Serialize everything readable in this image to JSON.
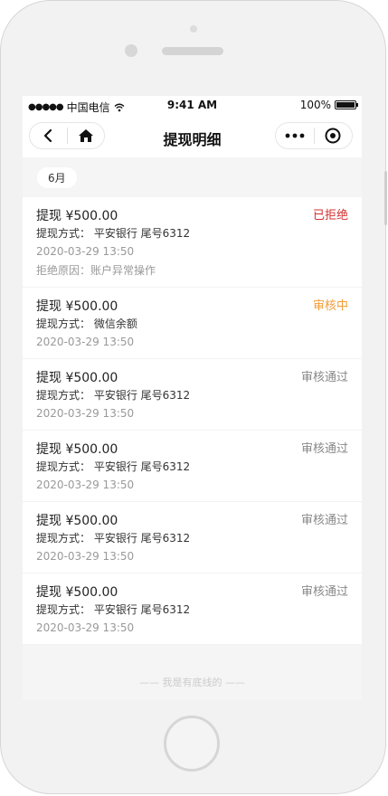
{
  "status_bar": {
    "signal": "●●●●●",
    "carrier": "中国电信",
    "time": "9:41 AM",
    "battery": "100%"
  },
  "nav": {
    "title": "提现明细",
    "icons": {
      "back": "chevron-left-icon",
      "home": "home-icon",
      "more": "more-dots-icon",
      "close": "target-circle-icon"
    }
  },
  "month_label": "6月",
  "colors": {
    "rejected": "#d43030",
    "pending": "#f29d38",
    "approved": "#888888"
  },
  "records": [
    {
      "amount": "提现 ¥500.00",
      "method": "提现方式： 平安银行 尾号6312",
      "time": "2020-03-29 13:50",
      "status": "已拒绝",
      "status_type": "rejected",
      "reason": "拒绝原因：账户异常操作"
    },
    {
      "amount": "提现 ¥500.00",
      "method": "提现方式： 微信余额",
      "time": "2020-03-29 13:50",
      "status": "审核中",
      "status_type": "pending"
    },
    {
      "amount": "提现 ¥500.00",
      "method": "提现方式： 平安银行 尾号6312",
      "time": "2020-03-29 13:50",
      "status": "审核通过",
      "status_type": "approved"
    },
    {
      "amount": "提现 ¥500.00",
      "method": "提现方式： 平安银行 尾号6312",
      "time": "2020-03-29 13:50",
      "status": "审核通过",
      "status_type": "approved"
    },
    {
      "amount": "提现 ¥500.00",
      "method": "提现方式： 平安银行 尾号6312",
      "time": "2020-03-29 13:50",
      "status": "审核通过",
      "status_type": "approved"
    },
    {
      "amount": "提现 ¥500.00",
      "method": "提现方式： 平安银行 尾号6312",
      "time": "2020-03-29 13:50",
      "status": "审核通过",
      "status_type": "approved"
    }
  ],
  "footer": "—— 我是有底线的 ——"
}
